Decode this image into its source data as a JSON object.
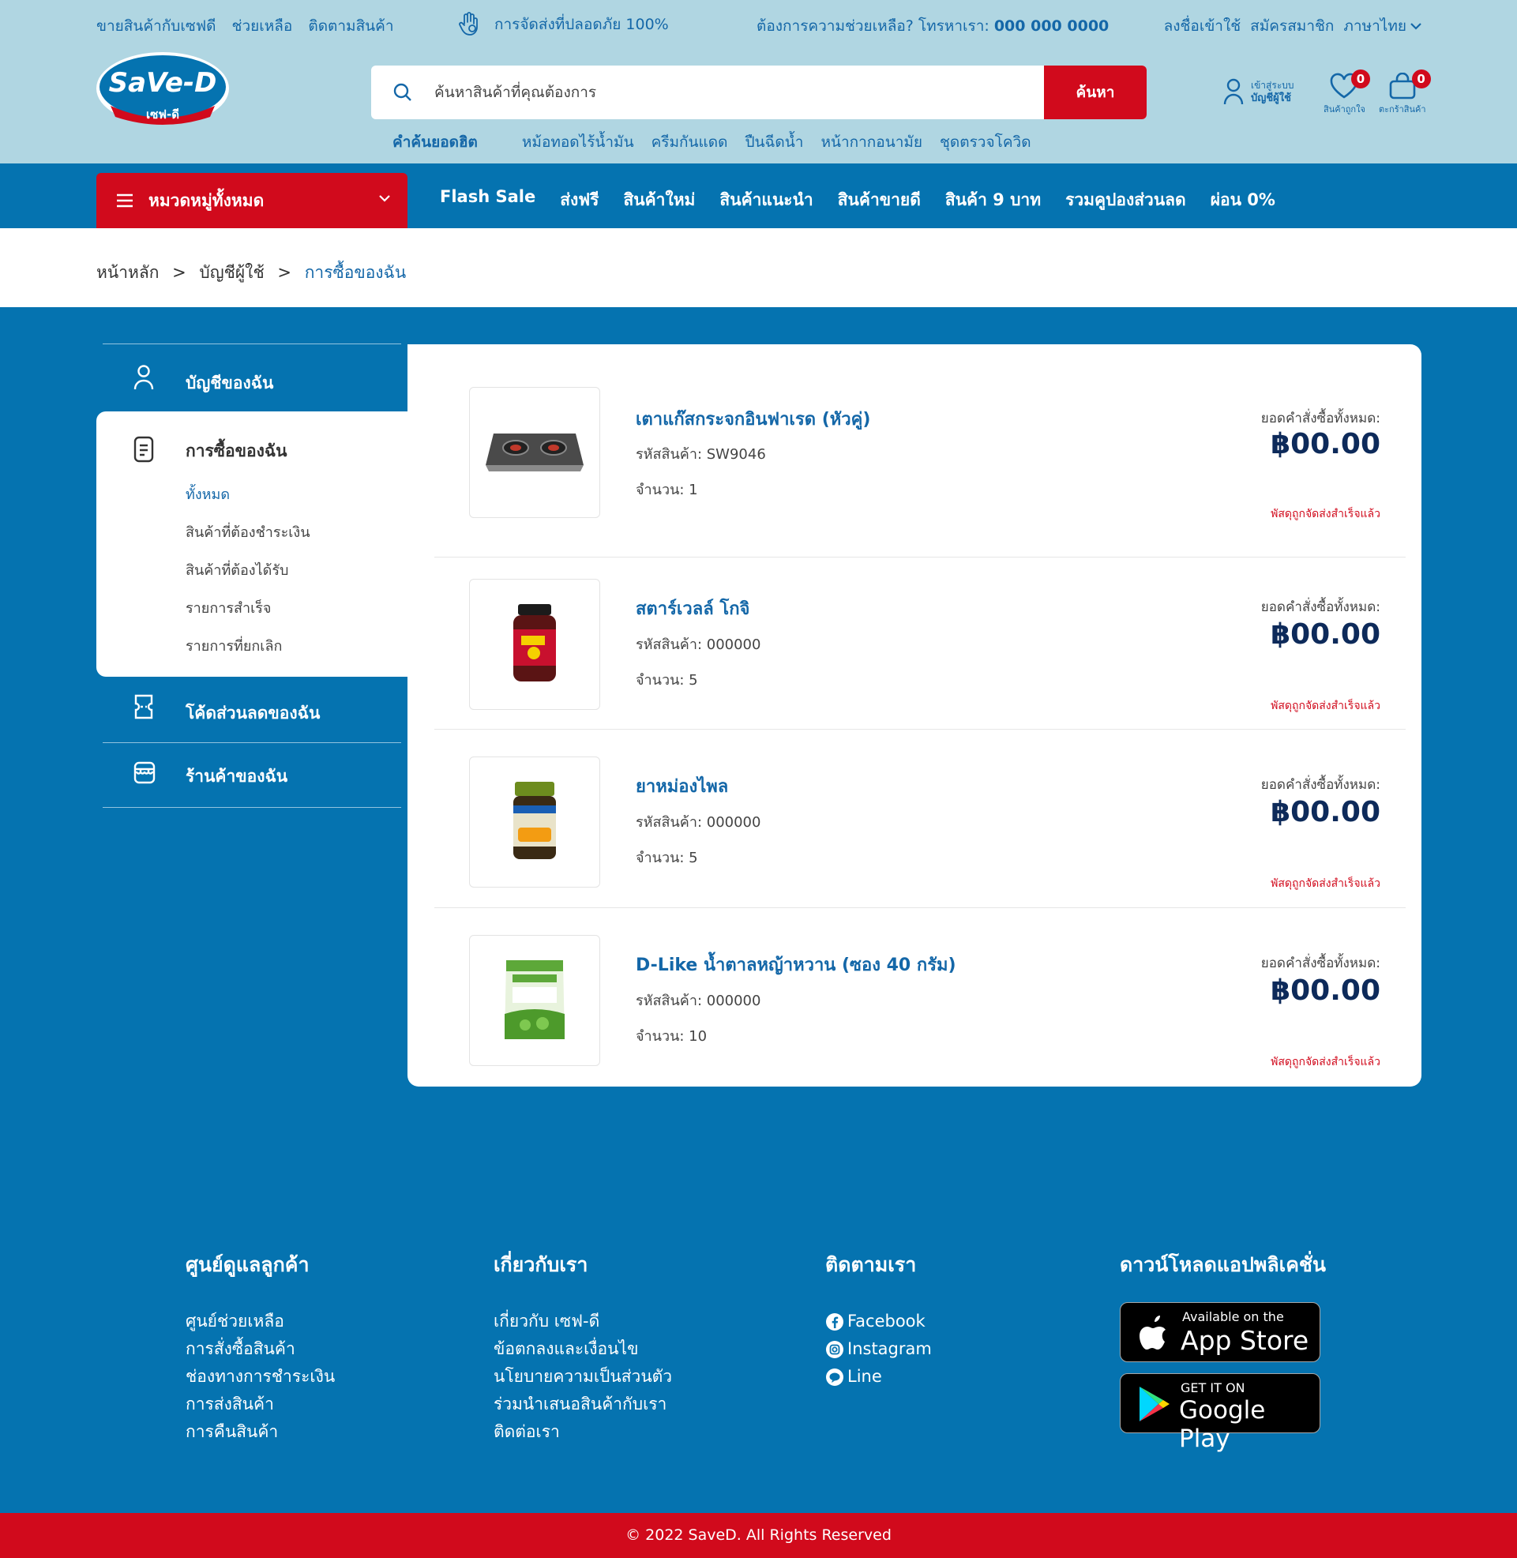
{
  "topbar": {
    "links": [
      "ขายสินค้ากับเซฟดี",
      "ช่วยเหลือ",
      "ติดตามสินค้า"
    ],
    "safe_delivery": "การจัดส่งที่ปลอดภัย 100%",
    "help_text": "ต้องการความช่วยเหลือ? โทรหาเรา:",
    "phone": "000 000 0000",
    "login": "ลงชื่อเข้าใช้",
    "register": "สมัครสมาชิก",
    "language": "ภาษาไทย"
  },
  "logo": {
    "brand": "SaVe-D",
    "thai": "เซฟ-ดี"
  },
  "search": {
    "placeholder": "ค้นหาสินค้าที่คุณต้องการ",
    "button": "ค้นหา",
    "hot_label": "คำค้นยอดฮิต",
    "hot_keywords": [
      "หม้อทอดไร้น้ำมัน",
      "ครีมกันแดด",
      "ปืนฉีดน้ำ",
      "หน้ากากอนามัย",
      "ชุดตรวจโควิด"
    ]
  },
  "account": {
    "line1": "เข้าสู่ระบบ",
    "line2": "บัญชีผู้ใช้"
  },
  "wishlist": {
    "label": "สินค้าถูกใจ",
    "count": "0"
  },
  "cart": {
    "label": "ตะกร้าสินค้า",
    "count": "0"
  },
  "nav": {
    "all_categories": "หมวดหมู่ทั้งหมด",
    "links": [
      "Flash Sale",
      "ส่งฟรี",
      "สินค้าใหม่",
      "สินค้าแนะนำ",
      "สินค้าขายดี",
      "สินค้า 9 บาท",
      "รวมคูปองส่วนลด",
      "ผ่อน 0%"
    ]
  },
  "breadcrumb": {
    "home": "หน้าหลัก",
    "account": "บัญชีผู้ใช้",
    "current": "การซื้อของฉัน",
    "sep": ">"
  },
  "sidebar": {
    "my_account": "บัญชีของฉัน",
    "my_purchases": "การซื้อของฉัน",
    "sub": [
      "ทั้งหมด",
      "สินค้าที่ต้องชำระเงิน",
      "สินค้าที่ต้องได้รับ",
      "รายการสำเร็จ",
      "รายการที่ยกเลิก"
    ],
    "my_coupons": "โค้ดส่วนลดของฉัน",
    "my_store": "ร้านค้าของฉัน"
  },
  "orders": [
    {
      "name": "เตาแก๊สกระจกอินฟาเรด (หัวคู่)",
      "sku": "รหัสสินค้า: SW9046",
      "qty": "จำนวน: 1",
      "total_label": "ยอดคำสั่งซื้อทั้งหมด:",
      "price": "฿00.00",
      "status": "พัสดุถูกจัดส่งสำเร็จแล้ว",
      "image": "gas-stove"
    },
    {
      "name": "สตาร์เวลล์ โกจิ",
      "sku": "รหัสสินค้า: 000000",
      "qty": "จำนวน: 5",
      "total_label": "ยอดคำสั่งซื้อทั้งหมด:",
      "price": "฿00.00",
      "status": "พัสดุถูกจัดส่งสำเร็จแล้ว",
      "image": "goji-bottle"
    },
    {
      "name": "ยาหม่องไพล",
      "sku": "รหัสสินค้า: 000000",
      "qty": "จำนวน: 5",
      "total_label": "ยอดคำสั่งซื้อทั้งหมด:",
      "price": "฿00.00",
      "status": "พัสดุถูกจัดส่งสำเร็จแล้ว",
      "image": "balm-jar"
    },
    {
      "name": "D-Like น้ำตาลหญ้าหวาน (ซอง 40 กรัม)",
      "sku": "รหัสสินค้า: 000000",
      "qty": "จำนวน: 10",
      "total_label": "ยอดคำสั่งซื้อทั้งหมด:",
      "price": "฿00.00",
      "status": "พัสดุถูกจัดส่งสำเร็จแล้ว",
      "image": "sweetener-pouch"
    }
  ],
  "footer": {
    "customer_center": {
      "title": "ศูนย์ดูแลลูกค้า",
      "links": [
        "ศูนย์ช่วยเหลือ",
        "การสั่งซื้อสินค้า",
        "ช่องทางการชำระเงิน",
        "การส่งสินค้า",
        "การคืนสินค้า"
      ]
    },
    "about": {
      "title": "เกี่ยวกับเรา",
      "links": [
        "เกี่ยวกับ เซฟ-ดี",
        "ข้อตกลงและเงื่อนไข",
        "นโยบายความเป็นส่วนตัว",
        "ร่วมนำเสนอสินค้ากับเรา",
        "ติดต่อเรา"
      ]
    },
    "follow": {
      "title": "ติดตามเรา",
      "links": [
        "Facebook",
        "Instagram",
        "Line"
      ]
    },
    "download": {
      "title": "ดาวน์โหลดแอปพลิเคชั่น",
      "appstore_small": "Available on the",
      "appstore_big": "App Store",
      "googleplay_small": "GET IT ON",
      "googleplay_big": "Google Play"
    },
    "copyright": "© 2022 SaveD. All Rights Reserved"
  },
  "colors": {
    "header_bg": "#b0d6e2",
    "primary_blue": "#0573b0",
    "brand_red": "#d10a1c",
    "link_blue": "#1467a8",
    "price_navy": "#0d2a5a"
  }
}
